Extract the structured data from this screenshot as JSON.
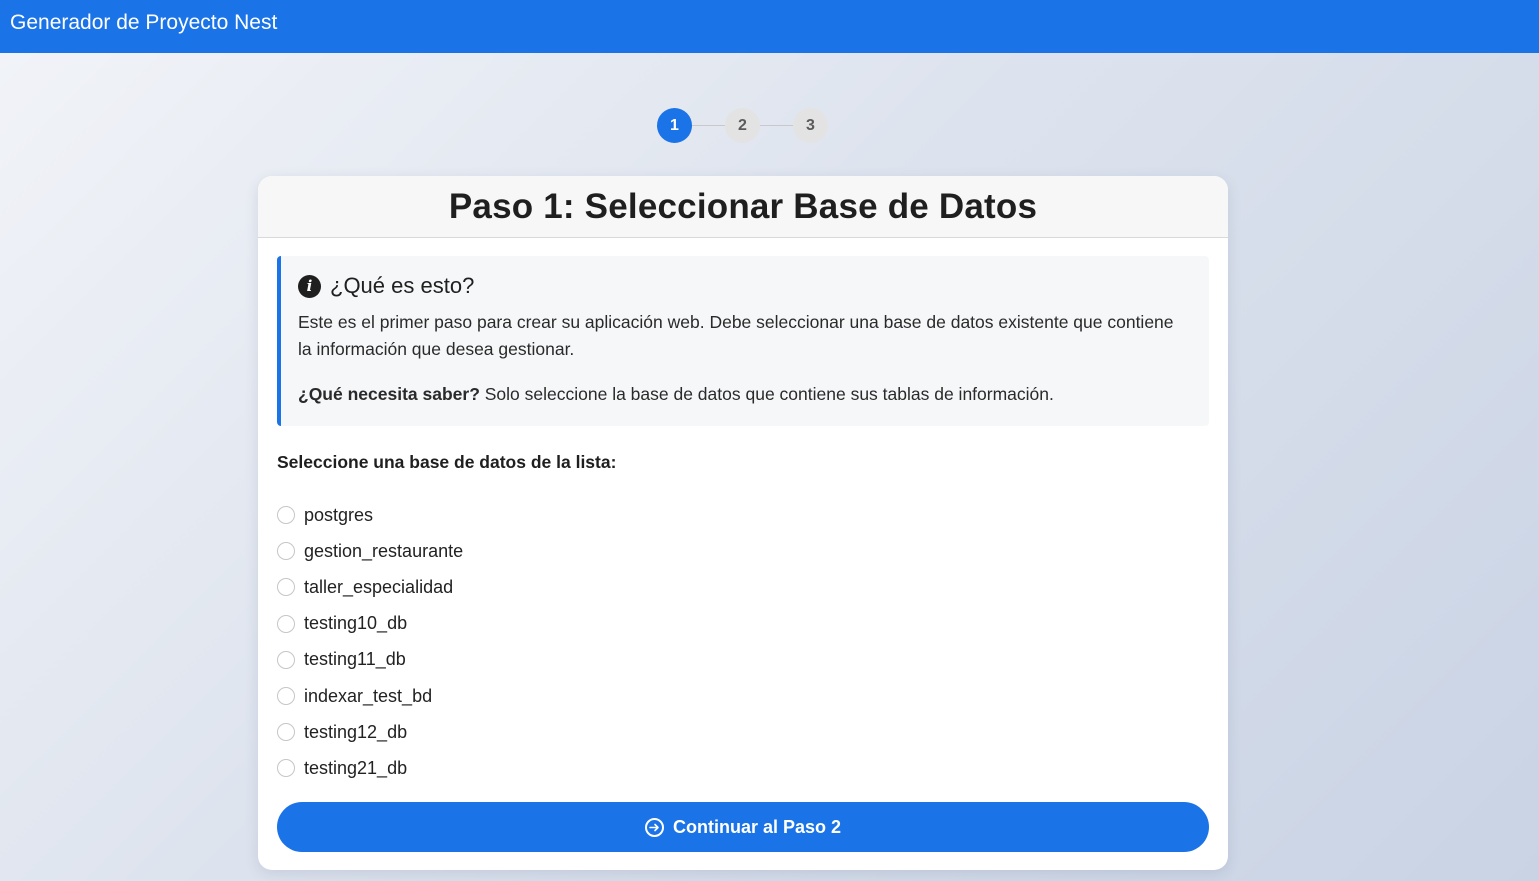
{
  "app": {
    "title": "Generador de Proyecto Nest"
  },
  "stepper": {
    "steps": [
      "1",
      "2",
      "3"
    ],
    "active_index": 0
  },
  "card": {
    "title": "Paso 1: Seleccionar Base de Datos",
    "info": {
      "heading": "¿Qué es esto?",
      "icon": "info-icon",
      "description": "Este es el primer paso para crear su aplicación web. Debe seleccionar una base de datos existente que contiene la información que desea gestionar.",
      "question_label": "¿Qué necesita saber?",
      "question_text": " Solo seleccione la base de datos que contiene sus tablas de información."
    },
    "select_label": "Seleccione una base de datos de la lista:",
    "databases": [
      "postgres",
      "gestion_restaurante",
      "taller_especialidad",
      "testing10_db",
      "testing11_db",
      "indexar_test_bd",
      "testing12_db",
      "testing21_db"
    ],
    "continue_button": "Continuar al Paso 2"
  },
  "colors": {
    "primary": "#1b73e8",
    "step_inactive": "#e3e3e3"
  }
}
